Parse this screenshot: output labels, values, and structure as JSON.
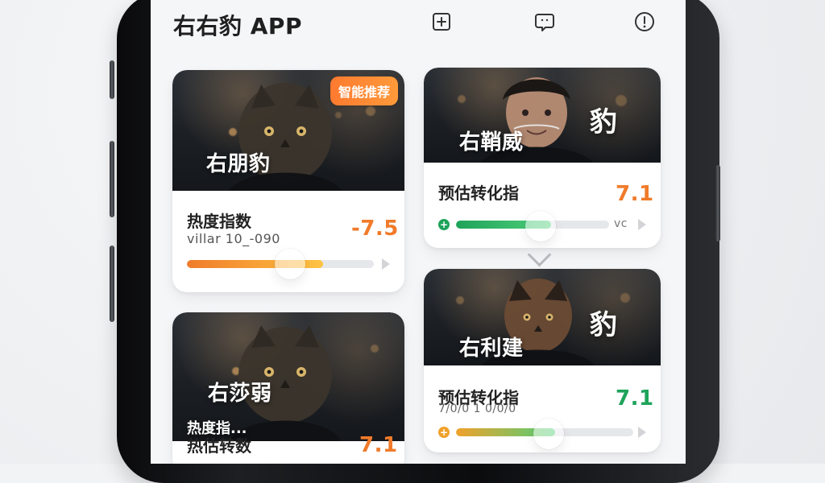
{
  "app": {
    "title": "右右豹 APP"
  },
  "topbar": {
    "icons": [
      "plus-square-icon",
      "message-square-icon",
      "alert-circle-icon"
    ]
  },
  "cards": {
    "left_top": {
      "badge": "智能推荐",
      "overlay_title": "右朋豹",
      "metric_label": "热度指数",
      "metric_sub": "villar 10_-090",
      "metric_value": "-7.5",
      "value_color": "#f07b2a",
      "progress": 0.73,
      "bar_colors": [
        "#f07b2a",
        "#ffc443"
      ]
    },
    "right_top": {
      "overlay_title": "右鞘威",
      "side_title": "豹",
      "metric_label": "预估转化指",
      "metric_value": "7.1",
      "value_color": "#f07b2a",
      "metric_tail": "vc",
      "progress": 0.62,
      "bar_colors": [
        "#1ea35a",
        "#4fd07a"
      ]
    },
    "left_bottom": {
      "overlay_title": "右莎弱",
      "overlay_line_1": "热度指...",
      "overlay_line_2": "热估转数",
      "metric_value": "7.1",
      "value_color": "#f07b2a"
    },
    "right_bottom": {
      "overlay_title": "右利建",
      "side_title": "豹",
      "metric_label": "预估转化指",
      "metric_sub": "7/0/0 1 0/0/0",
      "metric_value": "7.1",
      "value_color": "#1ea35a",
      "progress": 0.56,
      "bar_colors": [
        "#f0a12a",
        "#4fd07a"
      ]
    }
  }
}
